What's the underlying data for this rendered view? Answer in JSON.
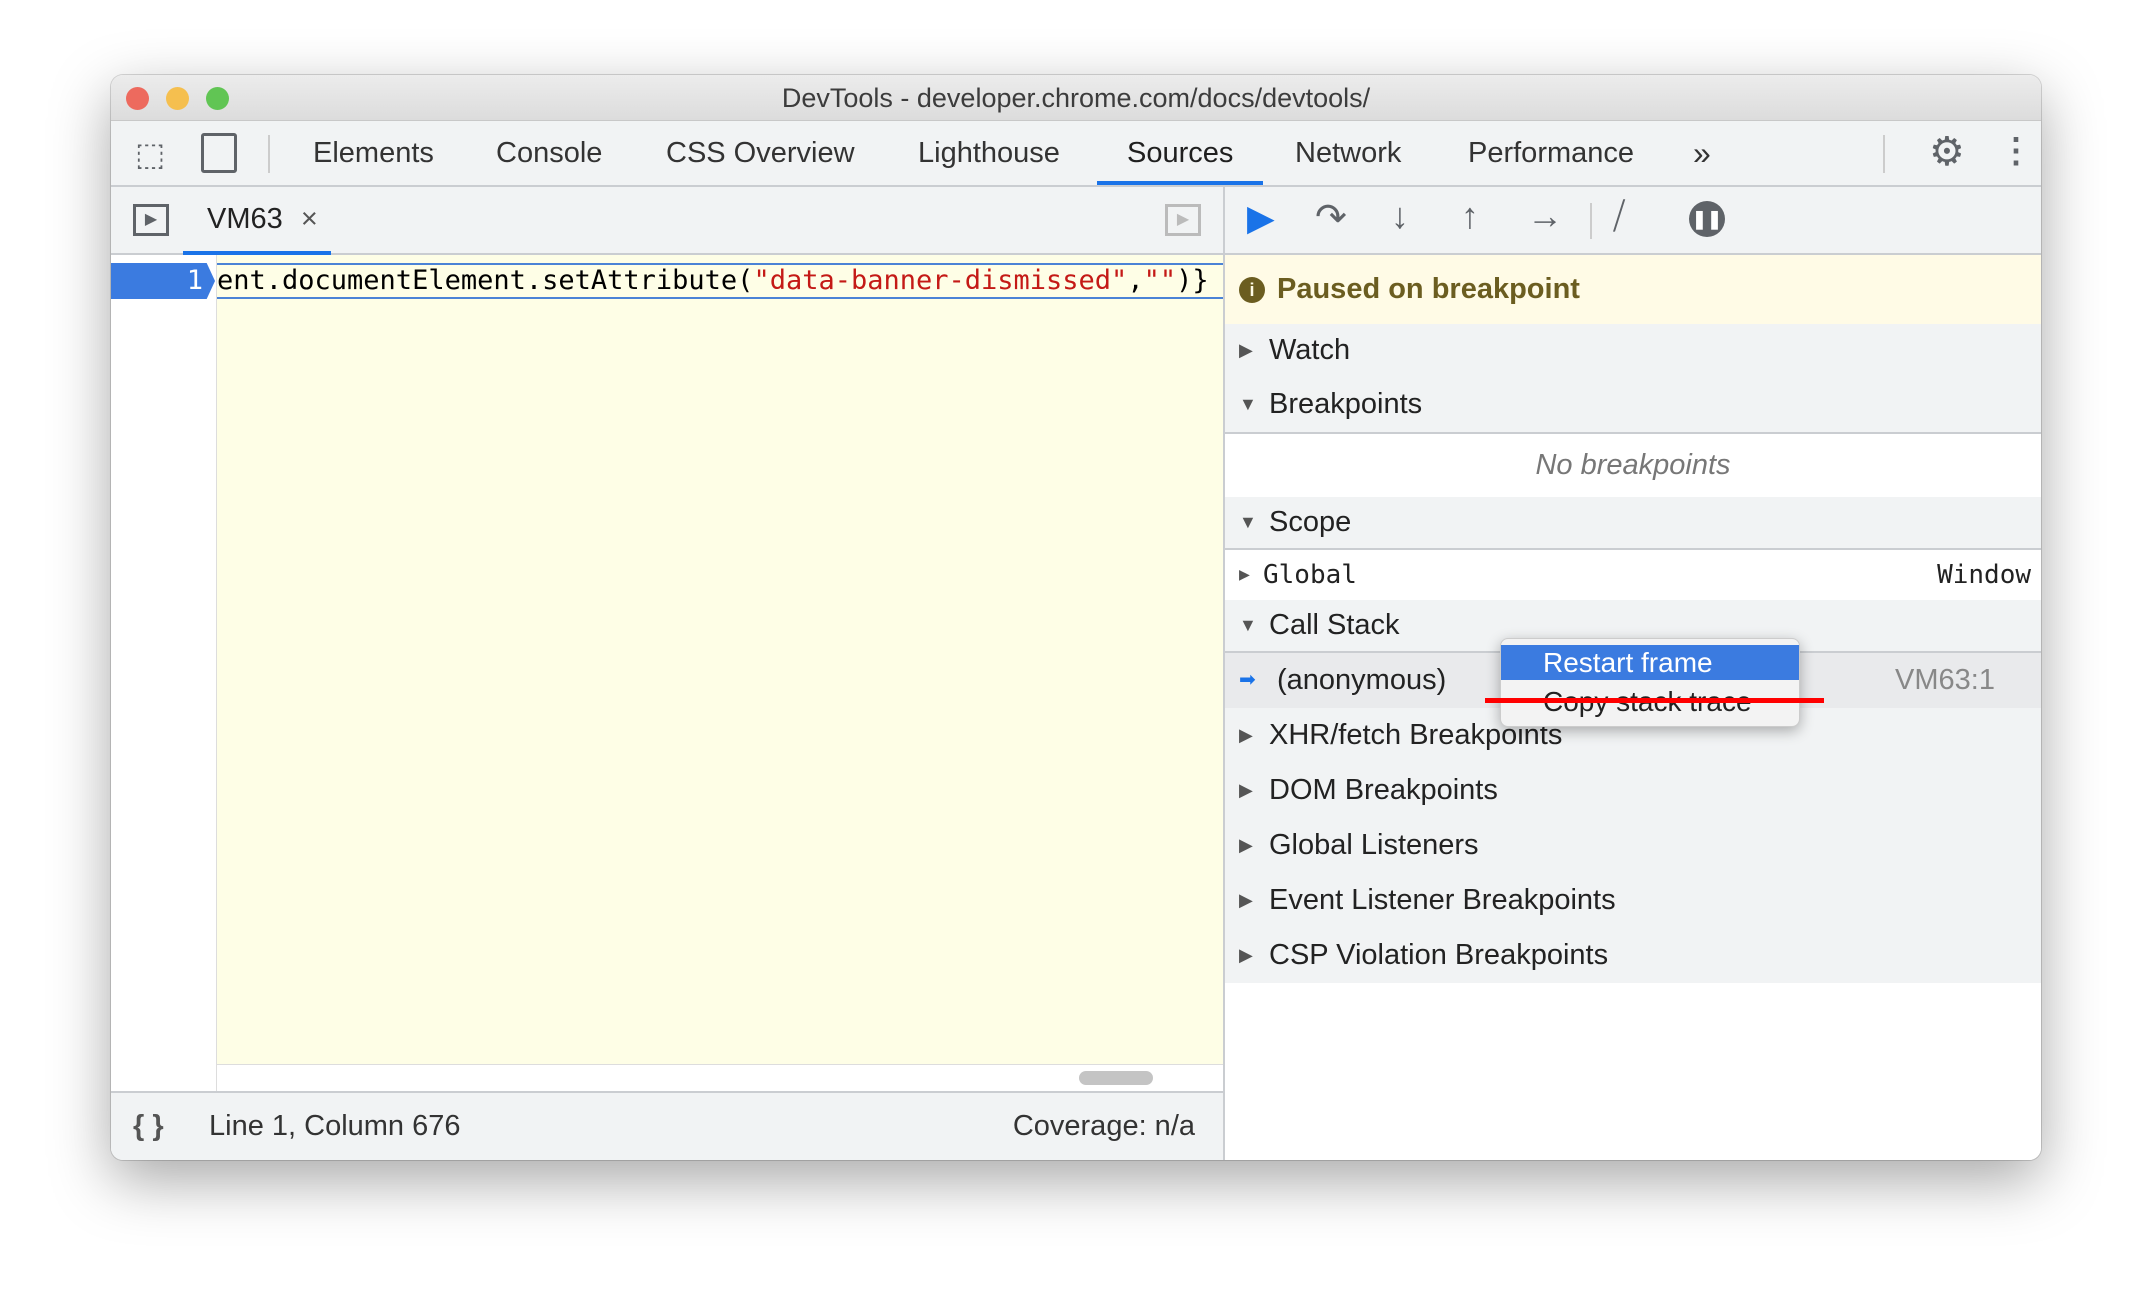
{
  "window": {
    "title": "DevTools - developer.chrome.com/docs/devtools/"
  },
  "tabs": [
    {
      "label": "Elements"
    },
    {
      "label": "Console"
    },
    {
      "label": "CSS Overview"
    },
    {
      "label": "Lighthouse"
    },
    {
      "label": "Sources",
      "active": true
    },
    {
      "label": "Network"
    },
    {
      "label": "Performance"
    }
  ],
  "file_tab": {
    "label": "VM63",
    "close": "×"
  },
  "editor": {
    "line_number": "1",
    "code_prefix": "ent.documentElement.setAttribute(",
    "code_string1": "\"data-banner-dismissed\"",
    "code_comma": ",",
    "code_string2": "\"\"",
    "code_suffix": ")}"
  },
  "status": {
    "position": "Line 1, Column 676",
    "coverage": "Coverage: n/a",
    "format_icon": "{ }"
  },
  "debugger": {
    "paused": "Paused on breakpoint",
    "watch": "Watch",
    "breakpoints": "Breakpoints",
    "no_breakpoints": "No breakpoints",
    "scope": "Scope",
    "global": "Global",
    "global_value": "Window",
    "call_stack": "Call Stack",
    "frame": "(anonymous)",
    "frame_location": "VM63:1",
    "sections": [
      "XHR/fetch Breakpoints",
      "DOM Breakpoints",
      "Global Listeners",
      "Event Listener Breakpoints",
      "CSP Violation Breakpoints"
    ]
  },
  "context_menu": {
    "items": [
      "Restart frame",
      "Copy stack trace"
    ]
  },
  "colors": {
    "accent": "#1a73e8",
    "annotation": "#ff0000",
    "paused_bg": "#fffbe6",
    "paused_text": "#6b5d20"
  }
}
